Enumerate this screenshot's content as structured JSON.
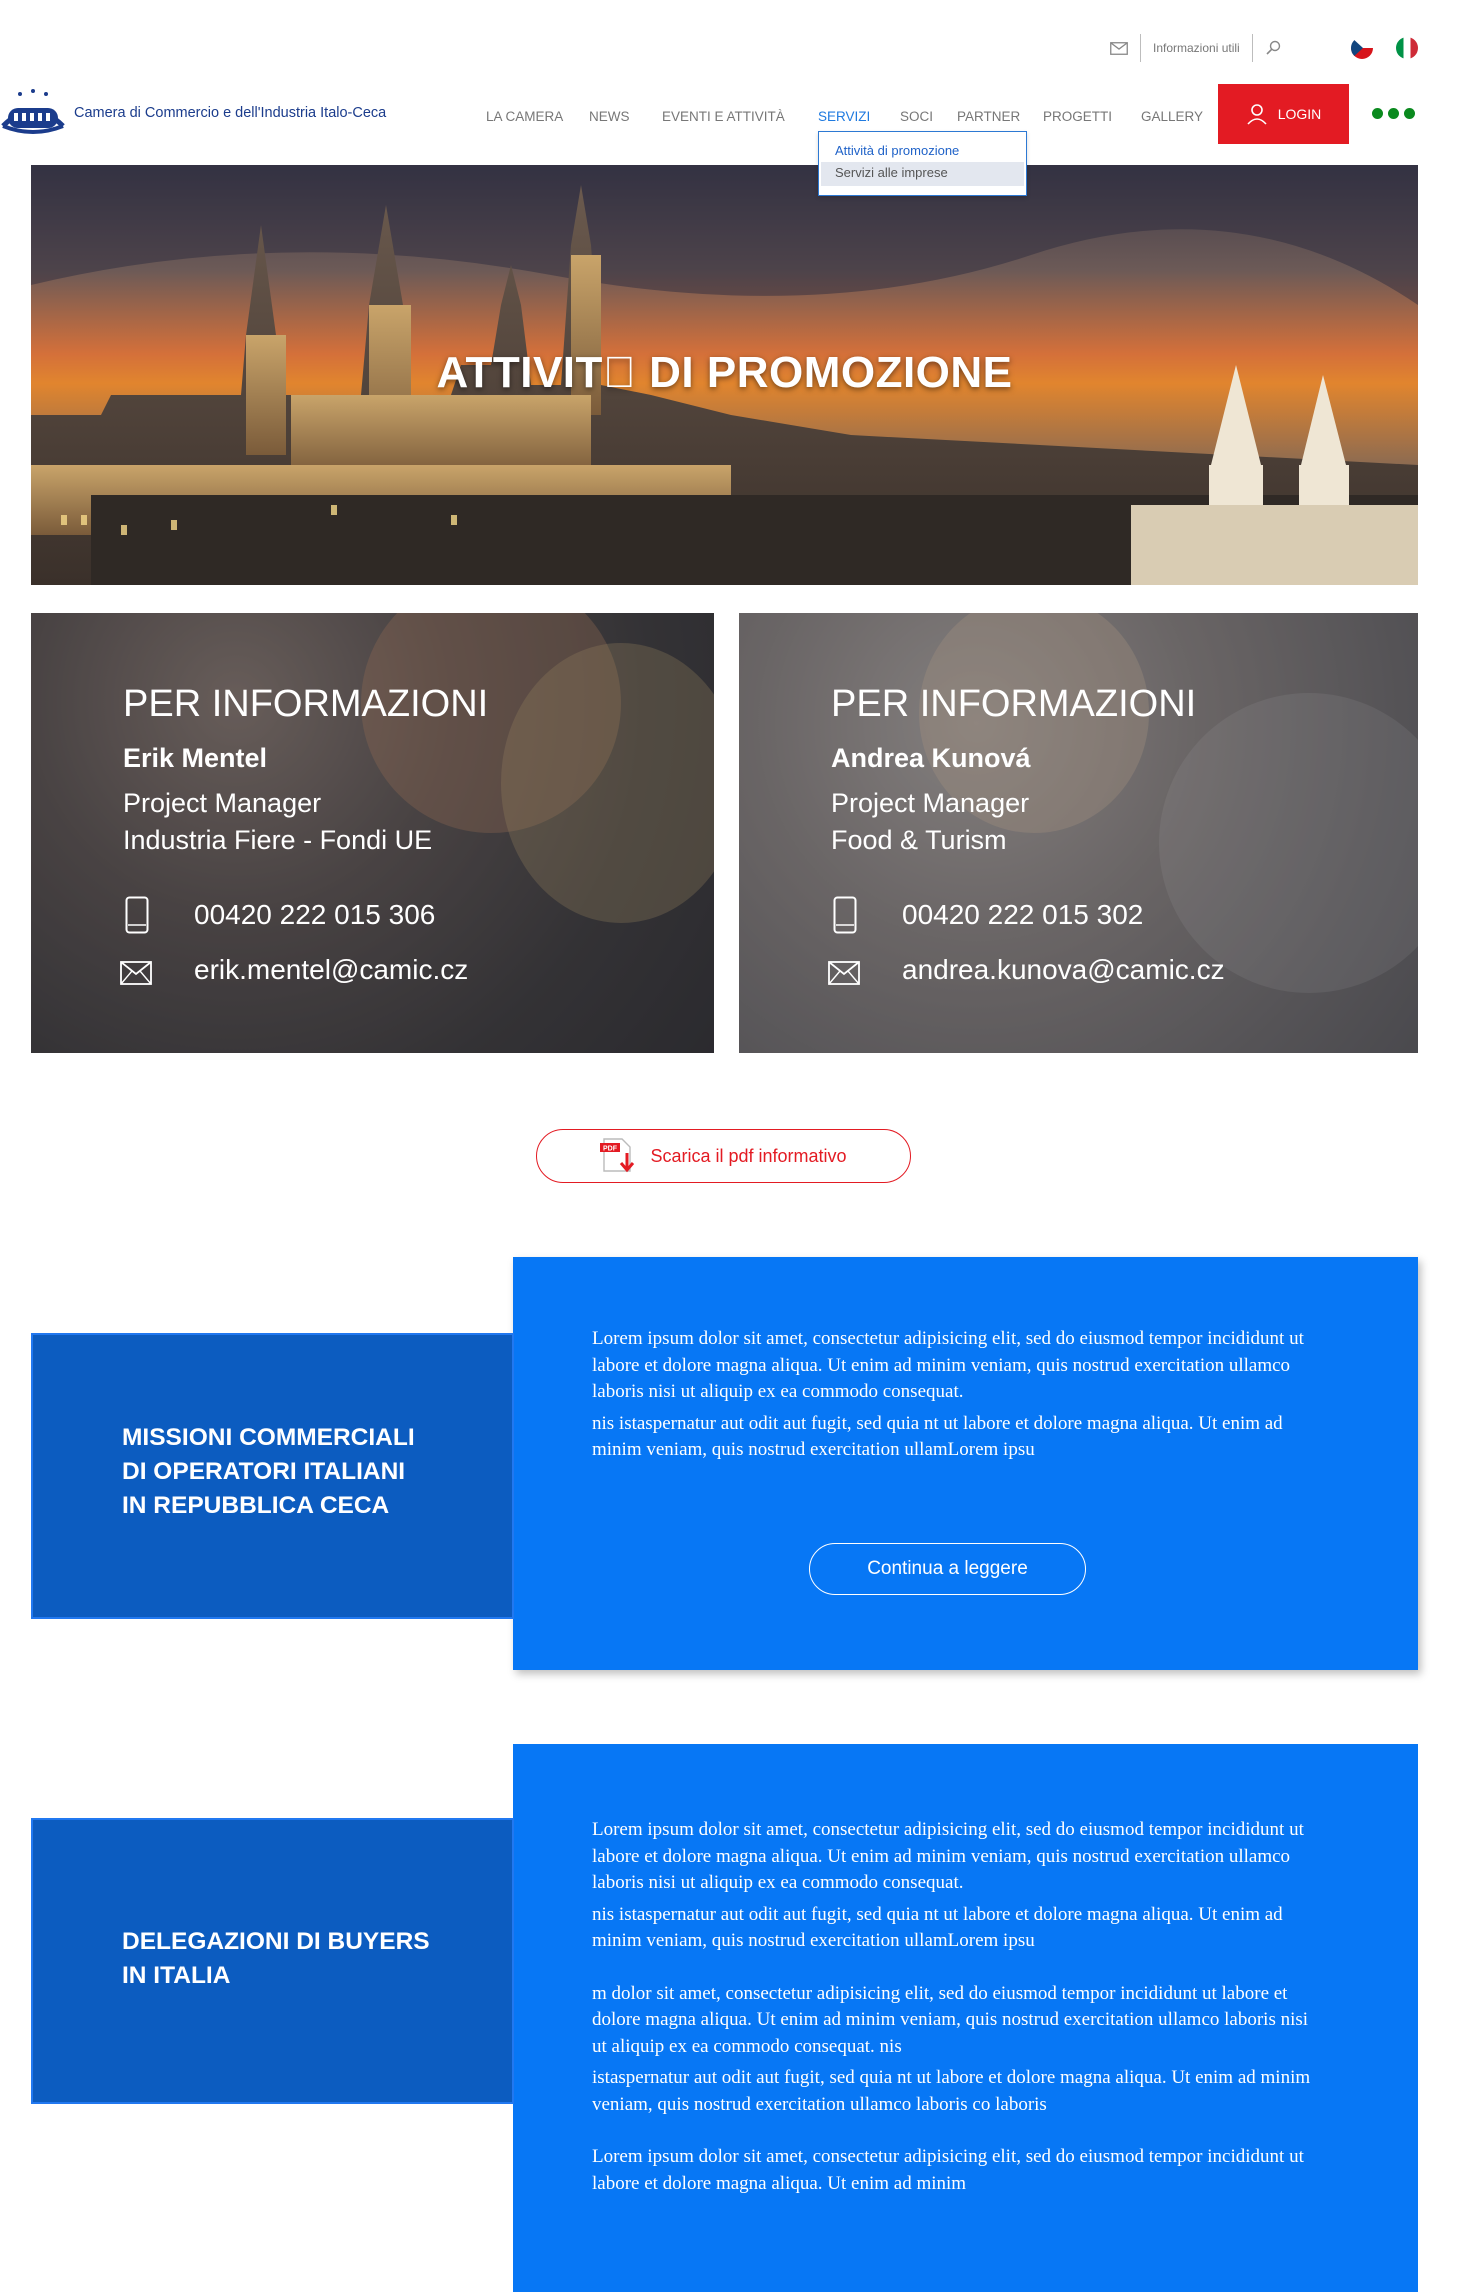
{
  "topbar": {
    "mail_icon": "mail-icon",
    "useful_info_label": "Informazioni utili",
    "search_icon": "search-icon",
    "languages": [
      "cz-flag",
      "it-flag"
    ]
  },
  "header": {
    "brand_name": "Camera di Commercio e dell'Industria Italo-Ceca",
    "nav": [
      "LA CAMERA",
      "NEWS",
      "EVENTI E ATTIVITÀ",
      "SERVIZI",
      "SOCI",
      "PARTNER",
      "PROGETTI",
      "GALLERY"
    ],
    "active_nav": "SERVIZI",
    "login_label": "LOGIN",
    "dropdown": [
      "Attività di promozione",
      "Servizi alle imprese"
    ]
  },
  "hero": {
    "title": "ATTIVIT\u0000 DI PROMOZIONE"
  },
  "contacts": [
    {
      "title": "PER INFORMAZIONI",
      "name": "Erik Mentel",
      "role": "Project Manager",
      "area": "Industria Fiere - Fondi UE",
      "phone": "00420 222 015 306",
      "email": "erik.mentel@camic.cz"
    },
    {
      "title": "PER INFORMAZIONI",
      "name": "Andrea Kunová",
      "role": "Project Manager",
      "area": "Food & Turism",
      "phone": "00420 222 015 302",
      "email": "andrea.kunova@camic.cz"
    }
  ],
  "pdf_button": {
    "label": "Scarica il pdf informativo",
    "icon": "pdf-download-icon"
  },
  "sections": [
    {
      "label_lines": [
        "MISSIONI COMMERCIALI",
        "DI OPERATORI ITALIANI",
        "IN REPUBBLICA CECA"
      ],
      "paragraphs": [
        "Lorem ipsum dolor sit amet, consectetur adipisicing elit, sed do eiusmod tempor incididunt ut labore et dolore magna aliqua. Ut enim ad minim veniam, quis nostrud exercitation ullamco laboris nisi ut aliquip ex ea commodo consequat.",
        "nis istaspernatur aut odit aut fugit, sed quia nt ut labore et dolore magna aliqua. Ut enim ad minim veniam, quis nostrud exercitation ullamLorem ipsu"
      ],
      "button_label": "Continua a leggere"
    },
    {
      "label_lines": [
        "DELEGAZIONI DI BUYERS",
        "IN ITALIA"
      ],
      "paragraphs": [
        "Lorem ipsum dolor sit amet, consectetur adipisicing elit, sed do eiusmod tempor incididunt ut labore et dolore magna aliqua. Ut enim ad minim veniam, quis nostrud exercitation ullamco laboris nisi ut aliquip ex ea commodo consequat.",
        "nis istaspernatur aut odit aut fugit, sed quia nt ut labore et dolore magna aliqua. Ut enim ad minim veniam, quis nostrud exercitation ullamLorem ipsu",
        "m dolor sit amet, consectetur adipisicing elit, sed do eiusmod tempor incididunt ut labore et dolore magna aliqua. Ut enim ad minim veniam, quis nostrud exercitation ullamco laboris nisi ut aliquip ex ea commodo consequat. nis",
        "istaspernatur aut odit aut fugit, sed quia nt ut labore et dolore magna aliqua. Ut enim ad minim veniam, quis nostrud exercitation ullamco laboris co laboris",
        "Lorem ipsum dolor sit amet, consectetur adipisicing elit, sed do eiusmod tempor incididunt ut labore et dolore magna aliqua. Ut enim ad minim"
      ]
    }
  ],
  "colors": {
    "accent_red": "#e31b23",
    "nav_active": "#1f7ae0",
    "section_label_bg": "#0c5cc0",
    "section_body_bg": "#0777f5",
    "more_dots": "#0a8a1e"
  }
}
